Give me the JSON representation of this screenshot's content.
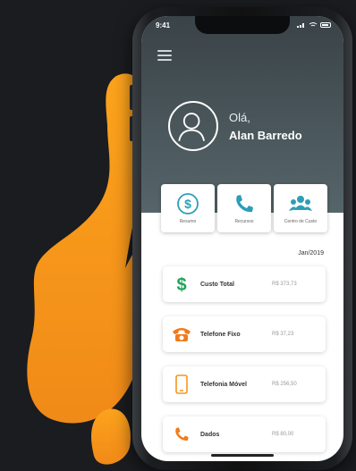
{
  "colors": {
    "accent": "#f7941d",
    "accent_dark": "#e06a12",
    "teal": "#2a9fb8",
    "background": "#1a1c1f"
  },
  "status_bar": {
    "time": "9:41"
  },
  "header": {
    "menu_icon": "hamburger-menu-icon",
    "greeting": "Olá,",
    "user_name": "Alan Barredo"
  },
  "actions": [
    {
      "label": "Resumo",
      "icon": "dollar-circle-icon"
    },
    {
      "label": "Recursos",
      "icon": "phone-icon"
    },
    {
      "label": "Centro de Custo",
      "icon": "users-group-icon"
    }
  ],
  "period": "Jan/2019",
  "cards": [
    {
      "label": "Custo Total",
      "value": "R$ 373,73",
      "icon": "dollar-sign-icon"
    },
    {
      "label": "Telefone Fixo",
      "value": "R$ 37,23",
      "icon": "landline-phone-icon"
    },
    {
      "label": "Telefonia Móvel",
      "value": "R$ 256,50",
      "icon": "mobile-phone-icon"
    },
    {
      "label": "Dados",
      "value": "R$ 80,00",
      "icon": "phone-handset-icon"
    }
  ]
}
